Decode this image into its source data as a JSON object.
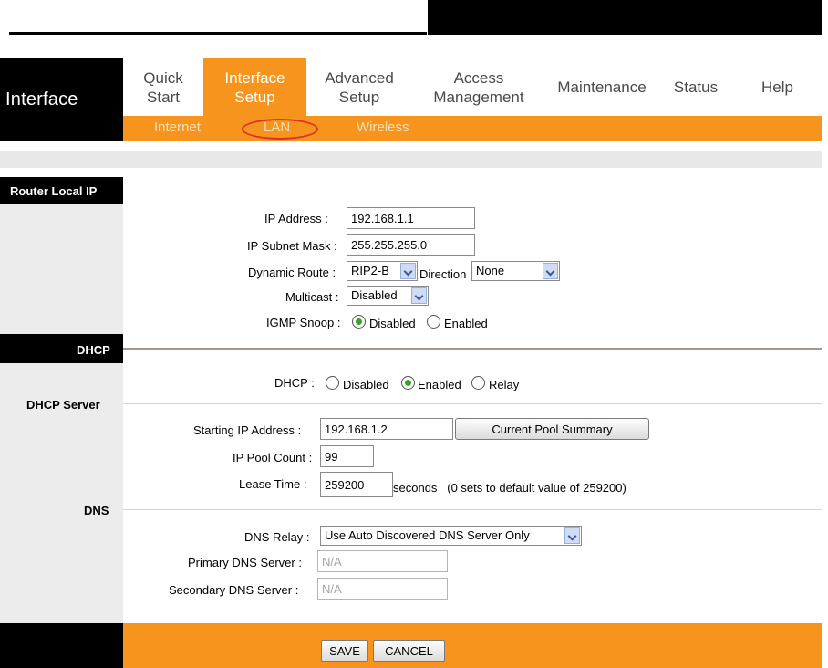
{
  "header": {
    "section_title": "Interface"
  },
  "nav": {
    "items": [
      {
        "line1": "Quick",
        "line2": "Start"
      },
      {
        "line1": "Interface",
        "line2": "Setup"
      },
      {
        "line1": "Advanced",
        "line2": "Setup"
      },
      {
        "line1": "Access",
        "line2": "Management"
      },
      {
        "line1": "Maintenance",
        "line2": ""
      },
      {
        "line1": "Status",
        "line2": ""
      },
      {
        "line1": "Help",
        "line2": ""
      }
    ],
    "active_index": 1,
    "subtabs": [
      "Internet",
      "LAN",
      "Wireless"
    ],
    "active_subtab": "LAN",
    "accent_color": "#f7941d",
    "highlight_color": "#e0302a"
  },
  "router_local_ip": {
    "section_label": "Router Local IP",
    "ip_address_label": "IP Address",
    "ip_address": "192.168.1.1",
    "subnet_mask_label": "IP Subnet Mask",
    "subnet_mask": "255.255.255.0",
    "dynamic_route_label": "Dynamic Route",
    "dynamic_route": "RIP2-B",
    "direction_label": "Direction",
    "direction": "None",
    "multicast_label": "Multicast",
    "multicast": "Disabled",
    "igmp_snoop_label": "IGMP Snoop",
    "igmp_options": [
      "Disabled",
      "Enabled"
    ],
    "igmp_selected": "Disabled"
  },
  "dhcp": {
    "section_label": "DHCP",
    "server_label": "DHCP Server",
    "dhcp_label": "DHCP",
    "options": [
      "Disabled",
      "Enabled",
      "Relay"
    ],
    "selected": "Enabled",
    "starting_ip_label": "Starting IP Address",
    "starting_ip": "192.168.1.2",
    "pool_summary_button": "Current Pool Summary",
    "pool_count_label": "IP Pool Count",
    "pool_count": "99",
    "lease_time_label": "Lease Time",
    "lease_time": "259200",
    "lease_note": "seconds   (0 sets to default value of 259200)"
  },
  "dns": {
    "section_label": "DNS",
    "relay_label": "DNS Relay",
    "relay": "Use Auto Discovered DNS Server Only",
    "primary_label": "Primary DNS Server",
    "primary": "N/A",
    "secondary_label": "Secondary DNS Server",
    "secondary": "N/A"
  },
  "footer": {
    "save_label": "SAVE",
    "cancel_label": "CANCEL"
  }
}
